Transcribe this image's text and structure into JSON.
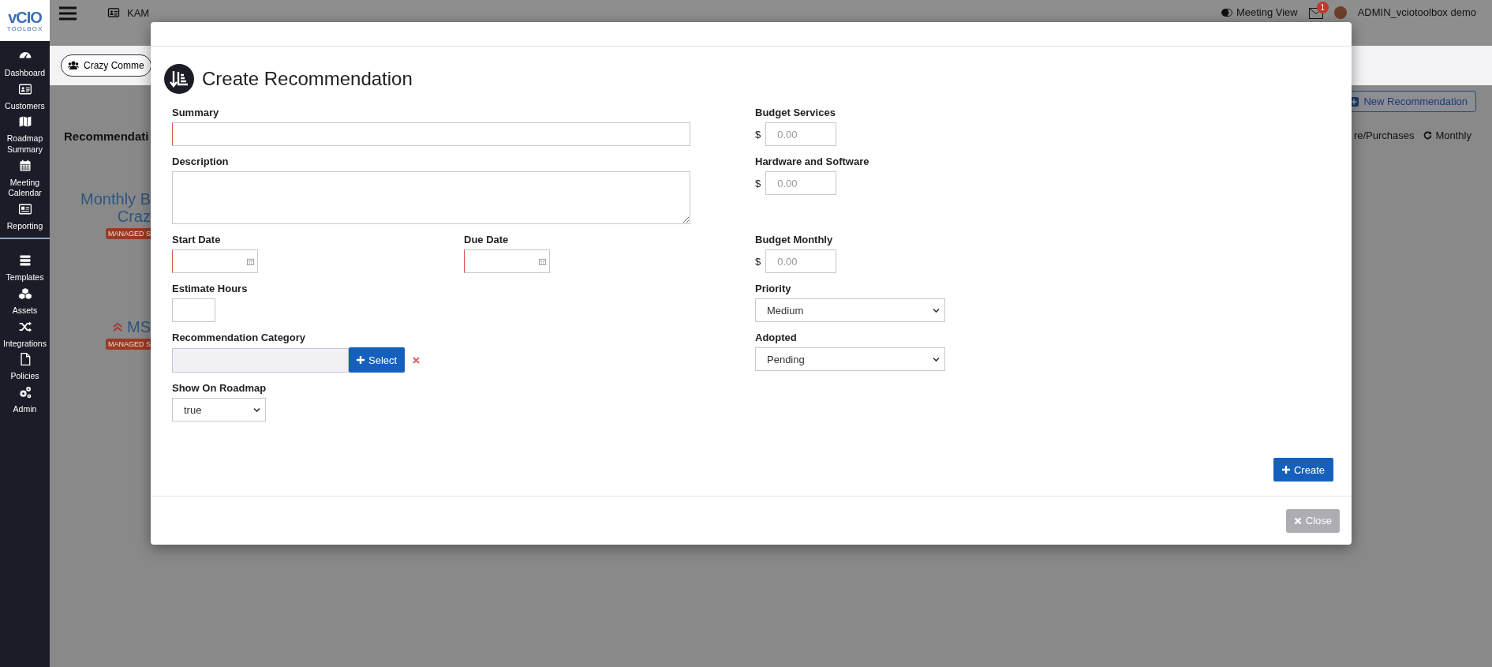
{
  "logo": {
    "name": "vCIO",
    "tagline": "TOOLBOX"
  },
  "sidebar": {
    "sections": [
      {
        "items": [
          {
            "label": "Dashboard",
            "kind": "gauge"
          },
          {
            "label": "Customers",
            "kind": "card"
          },
          {
            "label": "Roadmap Summary",
            "kind": "map"
          },
          {
            "label": "Meeting Calendar",
            "kind": "calendar"
          },
          {
            "label": "Reporting",
            "kind": "news"
          }
        ]
      },
      {
        "items": [
          {
            "label": "Templates",
            "kind": "stack"
          },
          {
            "label": "Assets",
            "kind": "cubes"
          },
          {
            "label": "Integrations",
            "kind": "shuffle"
          },
          {
            "label": "Policies",
            "kind": "file"
          },
          {
            "label": "Admin",
            "kind": "gears"
          }
        ]
      }
    ]
  },
  "topbar": {
    "tabs": [
      {
        "label": "KAM",
        "kind": "card"
      }
    ],
    "meeting_view": "Meeting View",
    "messages_badge": "1",
    "user": "ADMIN_vciotoolbox demo"
  },
  "customer_button": "Crazy Comme",
  "page": {
    "title": "Recommendati",
    "new_button": "New Recommendation",
    "filters": [
      {
        "label": "re/Purchases",
        "kind": "text"
      },
      {
        "label": "Monthly",
        "kind": "refresh"
      }
    ],
    "cards": [
      {
        "title_lines": [
          "Monthly B",
          "Craz"
        ],
        "tag": "MANAGED S",
        "raised": false
      },
      {
        "title_lines": [
          "MS"
        ],
        "tag": "MANAGED S",
        "raised": true
      }
    ]
  },
  "modal": {
    "title": "Create Recommendation",
    "rows": [
      {
        "left": [
          {
            "kind": "text",
            "label": "Summary",
            "required": true
          }
        ],
        "right": [
          {
            "kind": "money",
            "label": "Budget Services",
            "prefix": "$",
            "placeholder": "0.00"
          }
        ]
      },
      {
        "left": [
          {
            "kind": "textarea",
            "label": "Description",
            "required": false
          }
        ],
        "right": [
          {
            "kind": "money",
            "label": "Hardware and Software",
            "prefix": "$",
            "placeholder": "0.00"
          }
        ]
      },
      {
        "left": [
          {
            "kind": "date",
            "label": "Start Date",
            "required": true
          },
          {
            "kind": "date",
            "label": "Due Date",
            "required": true
          }
        ],
        "right": [
          {
            "kind": "money",
            "label": "Budget Monthly",
            "prefix": "$",
            "placeholder": "0.00"
          }
        ]
      },
      {
        "left": [
          {
            "kind": "number",
            "label": "Estimate Hours",
            "required": false
          }
        ],
        "right": [
          {
            "kind": "select",
            "label": "Priority",
            "value": "Medium"
          }
        ]
      },
      {
        "left": [
          {
            "kind": "picker",
            "label": "Recommendation Category",
            "button": "Select"
          }
        ],
        "right": [
          {
            "kind": "select",
            "label": "Adopted",
            "value": "Pending"
          }
        ]
      },
      {
        "left": [
          {
            "kind": "select-small",
            "label": "Show On Roadmap",
            "value": "true"
          }
        ],
        "right": []
      }
    ],
    "create_button": "Create",
    "close_button": "Close"
  }
}
